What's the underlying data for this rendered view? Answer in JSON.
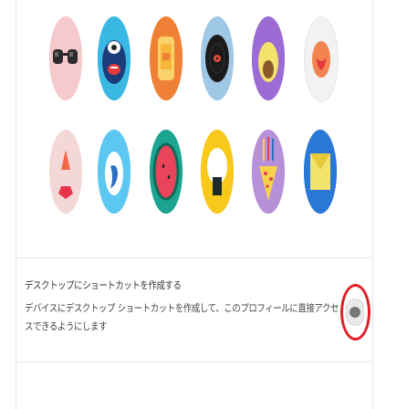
{
  "avatars": [
    {
      "name": "sunglasses-avatar",
      "bg": "#f6c9cc"
    },
    {
      "name": "monster-avatar",
      "bg": "#39b8e4"
    },
    {
      "name": "phone-avatar",
      "bg": "#f08035"
    },
    {
      "name": "record-avatar",
      "bg": "#9fc8e6"
    },
    {
      "name": "avocado-avatar",
      "bg": "#9c6bd4"
    },
    {
      "name": "heart-avatar",
      "bg": "#f2f2f2"
    },
    {
      "name": "pushpin-avatar",
      "bg": "#f4d8d8"
    },
    {
      "name": "dolphin-avatar",
      "bg": "#5cc8f2"
    },
    {
      "name": "watermelon-avatar",
      "bg": "#1da592"
    },
    {
      "name": "sushi-avatar",
      "bg": "#f8c81a"
    },
    {
      "name": "pizza-avatar",
      "bg": "#b690d8"
    },
    {
      "name": "envelope-avatar",
      "bg": "#2a78d6"
    }
  ],
  "setting": {
    "title": "デスクトップにショートカットを作成する",
    "description": "デバイスにデスクトップ ショートカットを作成して、このプロフィールに直接アクセスできるようにします",
    "toggle_on": false
  },
  "colors": {
    "highlight": "#e01f26",
    "toggle_track": "#e9e9e9",
    "toggle_knob": "#777777"
  }
}
